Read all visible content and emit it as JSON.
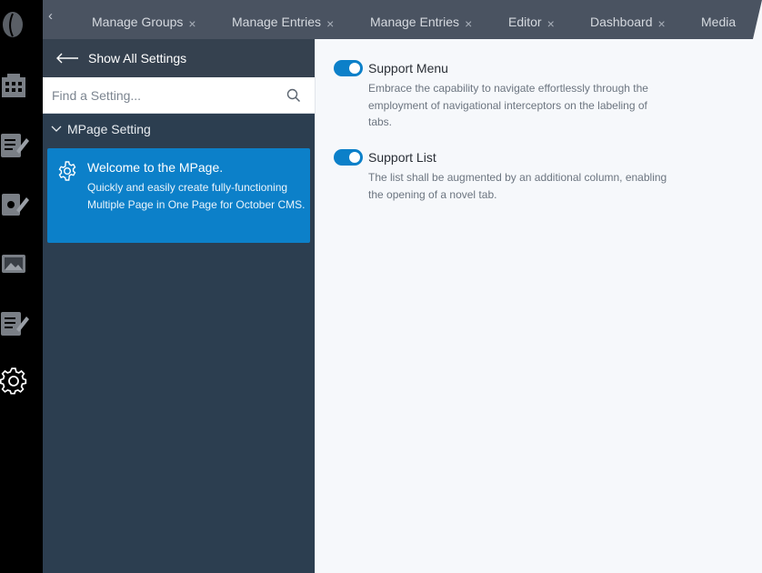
{
  "rail": {
    "items": [
      {
        "name": "logo-icon"
      },
      {
        "name": "building-icon"
      },
      {
        "name": "edit-page-icon"
      },
      {
        "name": "puzzle-edit-icon"
      },
      {
        "name": "media-image-icon"
      },
      {
        "name": "edit-page-icon"
      },
      {
        "name": "settings-gear-icon"
      }
    ]
  },
  "tabs": {
    "items": [
      {
        "label": "Manage Groups"
      },
      {
        "label": "Manage Entries"
      },
      {
        "label": "Manage Entries"
      },
      {
        "label": "Editor"
      },
      {
        "label": "Dashboard"
      },
      {
        "label": "Media"
      }
    ],
    "close_glyph": "×"
  },
  "sidebar": {
    "back_label": "Show All Settings",
    "search_placeholder": "Find a Setting...",
    "group_label": "MPage Setting",
    "card": {
      "title": "Welcome to the MPage.",
      "description": "Quickly and easily create fully-functioning Multiple Page in One Page for October CMS."
    }
  },
  "main": {
    "options": [
      {
        "label": "Support Menu",
        "enabled": true,
        "description": "Embrace the capability to navigate effortlessly through the employment of navigational interceptors on the labeling of tabs."
      },
      {
        "label": "Support List",
        "enabled": true,
        "description": "The list shall be augmented by an additional column, enabling the opening of a novel tab."
      }
    ]
  },
  "colors": {
    "rail_bg": "#000000",
    "tabbar_bg": "#4a5361",
    "sidebar_bg": "#2c3e50",
    "accent": "#0c80c9",
    "main_bg": "#f6f8fb"
  }
}
